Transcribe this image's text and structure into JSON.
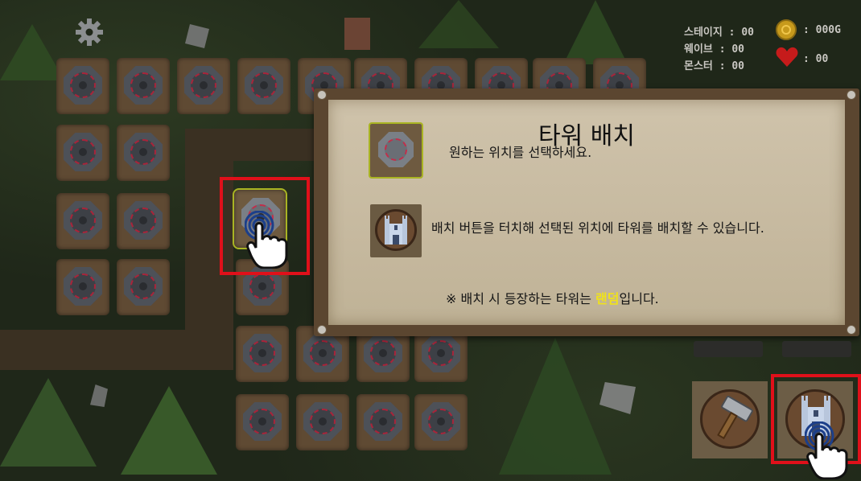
{
  "hud": {
    "stage_label": "스테이지 : 00",
    "wave_label": "웨이브 : 00",
    "monster_label": "몬스터 : 00",
    "gold_value": ": 000G",
    "life_value": ": 00",
    "icons": {
      "settings": "gear-icon",
      "gold": "coin-icon",
      "life": "heart-icon"
    }
  },
  "dialog": {
    "title": "타워 배치",
    "step1_text": "원하는 위치를 선택하세요.",
    "step2_text": "배치 버튼을 터치해 선택된 위치에 타워를 배치할 수 있습니다.",
    "note_prefix": "※ 배치 시 등장하는 타워는 ",
    "note_highlight": "랜덤",
    "note_suffix": "입니다."
  },
  "buttons": {
    "upgrade": "hammer-icon",
    "place_tower": "castle-icon"
  },
  "colors": {
    "highlight_text": "#f0e21a",
    "tutorial_box": "#e0101a",
    "selected_tile_border": "#a9b423"
  }
}
